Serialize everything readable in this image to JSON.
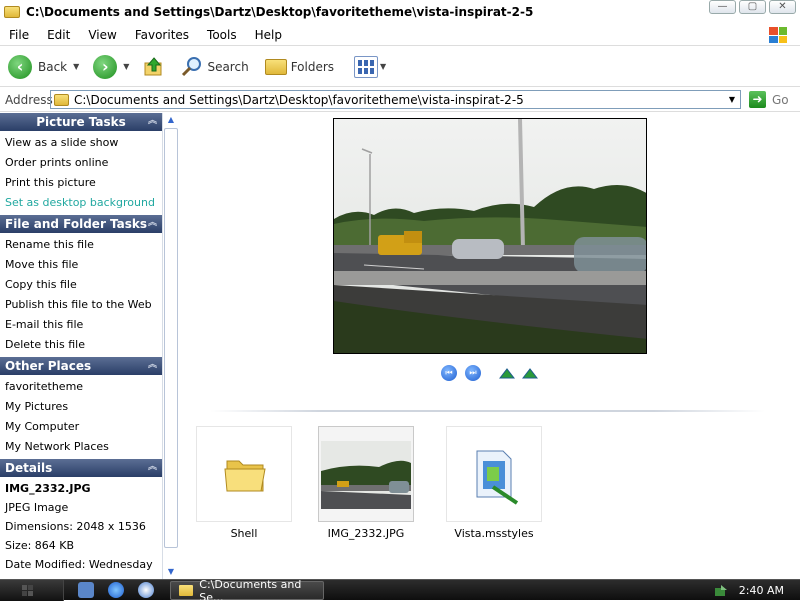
{
  "window": {
    "title": "C:\\Documents and Settings\\Dartz\\Desktop\\favoritetheme\\vista-inspirat-2-5",
    "minimize_glyph": "—",
    "maximize_glyph": "▢",
    "close_glyph": "✕"
  },
  "menu": [
    "File",
    "Edit",
    "View",
    "Favorites",
    "Tools",
    "Help"
  ],
  "toolbar": {
    "back_label": "Back",
    "search_label": "Search",
    "folders_label": "Folders",
    "back_icon": "back-arrow-icon",
    "forward_icon": "forward-arrow-icon"
  },
  "address": {
    "label": "Address",
    "value": "C:\\Documents and Settings\\Dartz\\Desktop\\favoritetheme\\vista-inspirat-2-5",
    "go_label": "Go"
  },
  "sidebar": {
    "picture_tasks": {
      "title": "Picture Tasks",
      "items": [
        "View as a slide show",
        "Order prints online",
        "Print this picture",
        "Set as desktop background"
      ]
    },
    "file_folder_tasks": {
      "title": "File and Folder Tasks",
      "items": [
        "Rename this file",
        "Move this file",
        "Copy this file",
        "Publish this file to the Web",
        "E-mail this file",
        "Delete this file"
      ]
    },
    "other_places": {
      "title": "Other Places",
      "items": [
        "favoritetheme",
        "My Pictures",
        "My Computer",
        "My Network Places"
      ]
    },
    "details": {
      "title": "Details",
      "name": "IMG_2332.JPG",
      "type": "JPEG Image",
      "dimensions": "Dimensions: 2048 x 1536",
      "size": "Size: 864 KB",
      "modified": "Date Modified: Wednesday"
    }
  },
  "files": [
    {
      "name": "Shell",
      "icon": "folder-icon"
    },
    {
      "name": "IMG_2332.JPG",
      "icon": "photo-thumbnail",
      "selected": true
    },
    {
      "name": "Vista.msstyles",
      "icon": "msstyles-file-icon"
    }
  ],
  "taskbar": {
    "task_label": "C:\\Documents and Se...",
    "clock": "2:40 AM"
  },
  "colors": {
    "panel_header": "#2a3e67",
    "highlight_task": "#21a8a0",
    "taskbar": "#111111"
  }
}
